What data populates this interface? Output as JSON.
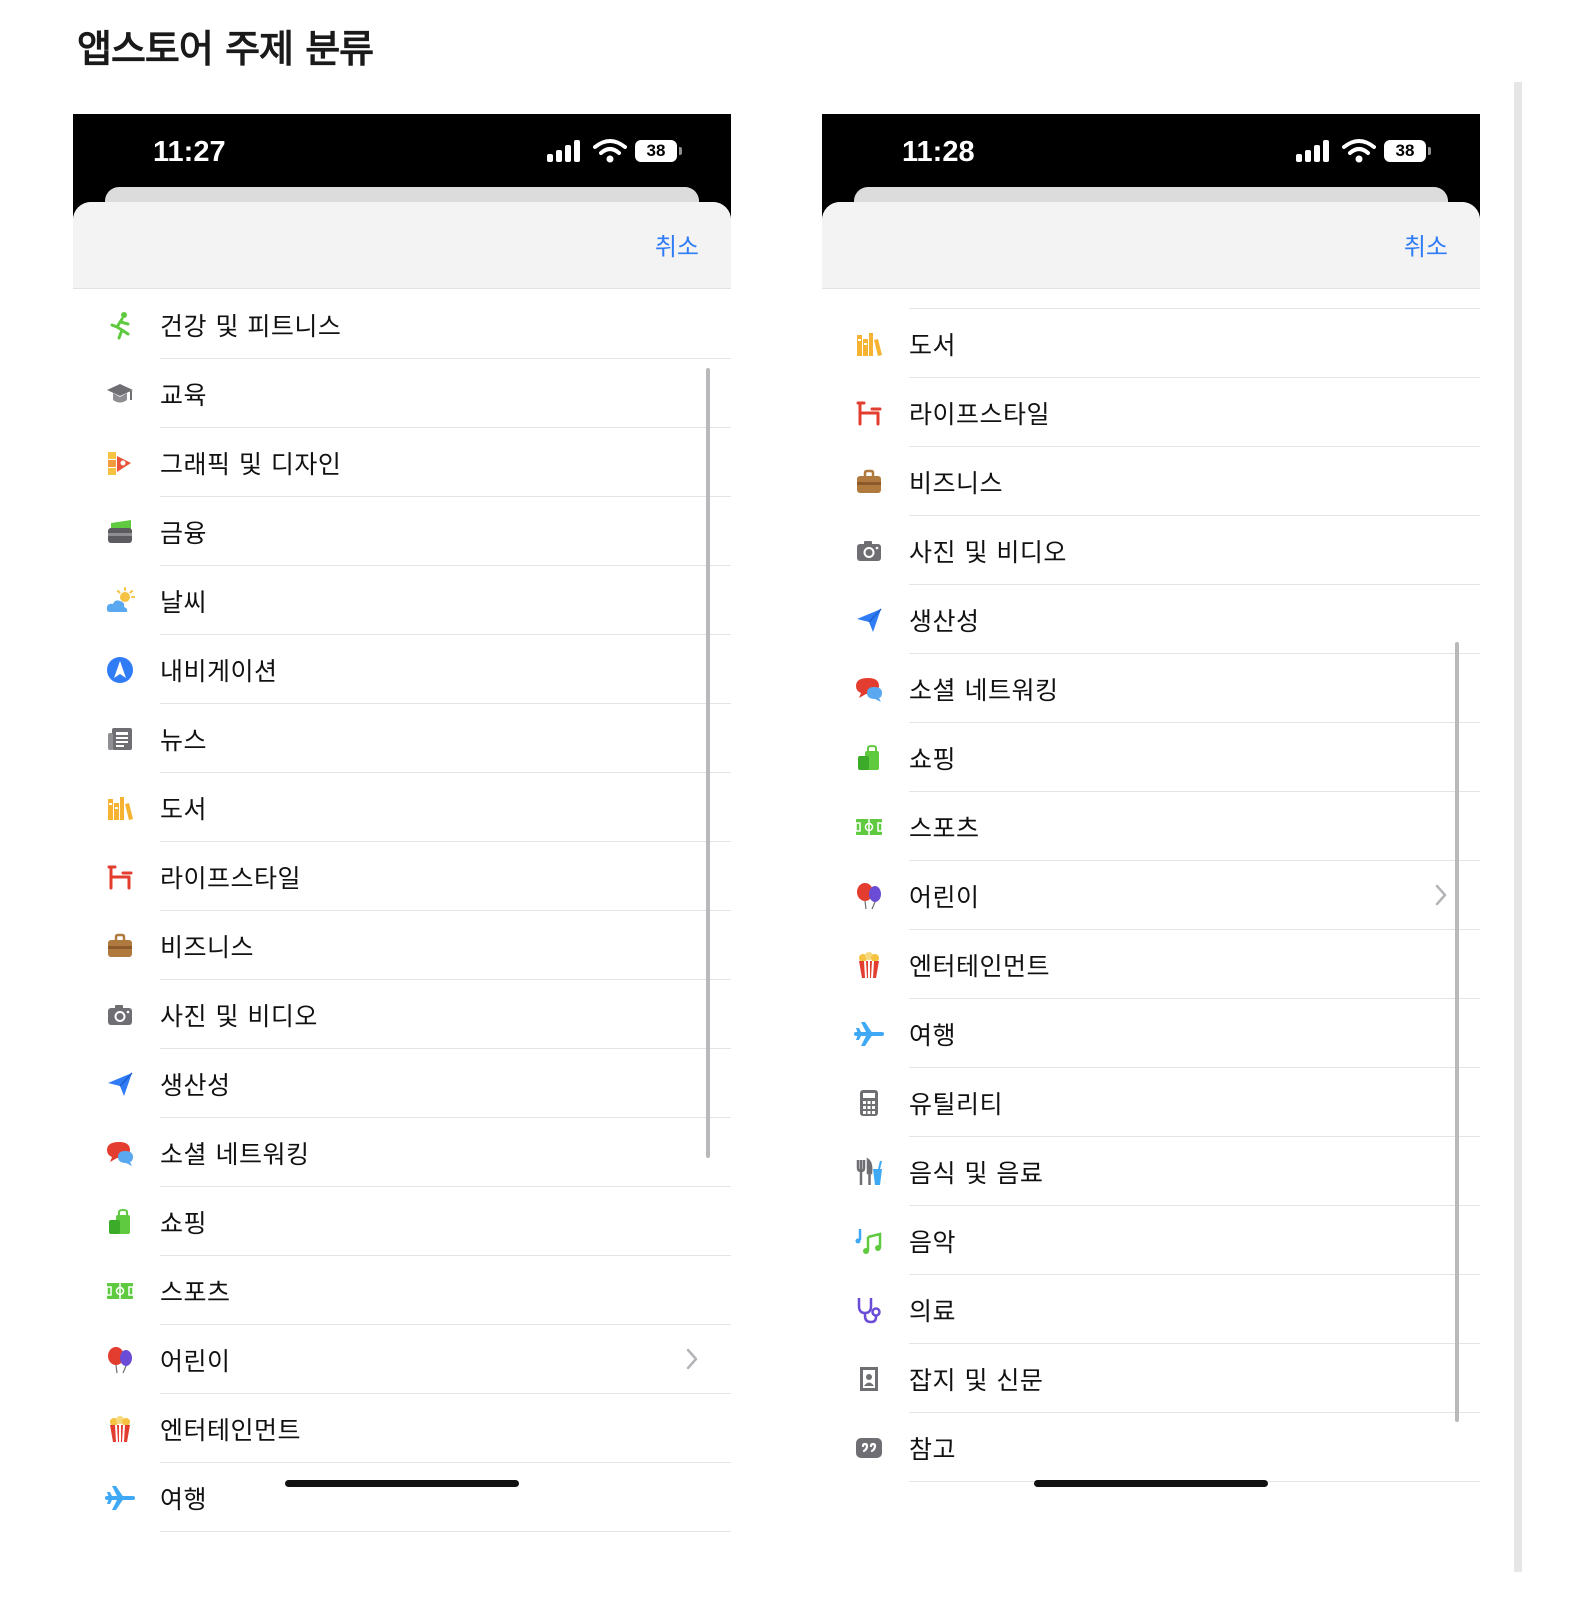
{
  "page": {
    "title": "앱스토어 주제 분류"
  },
  "colors": {
    "accent": "#2f7cf6",
    "statusBar": "#000000",
    "sheetHeader": "#f3f3f4",
    "separator": "#e4e4e6"
  },
  "left": {
    "status": {
      "time": "11:27",
      "battery": "38"
    },
    "cancel_label": "취소",
    "items": [
      {
        "label": "건강 및 피트니스",
        "icon": "running-figure-icon"
      },
      {
        "label": "교육",
        "icon": "graduation-cap-icon"
      },
      {
        "label": "그래픽 및 디자인",
        "icon": "paint-palette-icon"
      },
      {
        "label": "금융",
        "icon": "wallet-icon"
      },
      {
        "label": "날씨",
        "icon": "sun-cloud-icon"
      },
      {
        "label": "내비게이션",
        "icon": "compass-icon"
      },
      {
        "label": "뉴스",
        "icon": "newspaper-icon"
      },
      {
        "label": "도서",
        "icon": "books-icon"
      },
      {
        "label": "라이프스타일",
        "icon": "chair-icon"
      },
      {
        "label": "비즈니스",
        "icon": "briefcase-icon"
      },
      {
        "label": "사진 및 비디오",
        "icon": "camera-icon"
      },
      {
        "label": "생산성",
        "icon": "paper-plane-icon"
      },
      {
        "label": "소셜 네트워킹",
        "icon": "chat-bubbles-icon"
      },
      {
        "label": "쇼핑",
        "icon": "shopping-bags-icon"
      },
      {
        "label": "스포츠",
        "icon": "sports-field-icon"
      },
      {
        "label": "어린이",
        "icon": "balloons-icon",
        "chevron": true
      },
      {
        "label": "엔터테인먼트",
        "icon": "popcorn-icon"
      },
      {
        "label": "여행",
        "icon": "airplane-icon"
      }
    ]
  },
  "right": {
    "status": {
      "time": "11:28",
      "battery": "38"
    },
    "cancel_label": "취소",
    "items": [
      {
        "label": "도서",
        "icon": "books-icon"
      },
      {
        "label": "라이프스타일",
        "icon": "chair-icon"
      },
      {
        "label": "비즈니스",
        "icon": "briefcase-icon"
      },
      {
        "label": "사진 및 비디오",
        "icon": "camera-icon"
      },
      {
        "label": "생산성",
        "icon": "paper-plane-icon"
      },
      {
        "label": "소셜 네트워킹",
        "icon": "chat-bubbles-icon"
      },
      {
        "label": "쇼핑",
        "icon": "shopping-bags-icon"
      },
      {
        "label": "스포츠",
        "icon": "sports-field-icon"
      },
      {
        "label": "어린이",
        "icon": "balloons-icon",
        "chevron": true
      },
      {
        "label": "엔터테인먼트",
        "icon": "popcorn-icon"
      },
      {
        "label": "여행",
        "icon": "airplane-icon"
      },
      {
        "label": "유틸리티",
        "icon": "calculator-icon"
      },
      {
        "label": "음식 및 음료",
        "icon": "fork-knife-icon"
      },
      {
        "label": "음악",
        "icon": "music-notes-icon"
      },
      {
        "label": "의료",
        "icon": "stethoscope-icon"
      },
      {
        "label": "잡지 및 신문",
        "icon": "magazine-icon"
      },
      {
        "label": "참고",
        "icon": "quote-icon"
      }
    ]
  }
}
